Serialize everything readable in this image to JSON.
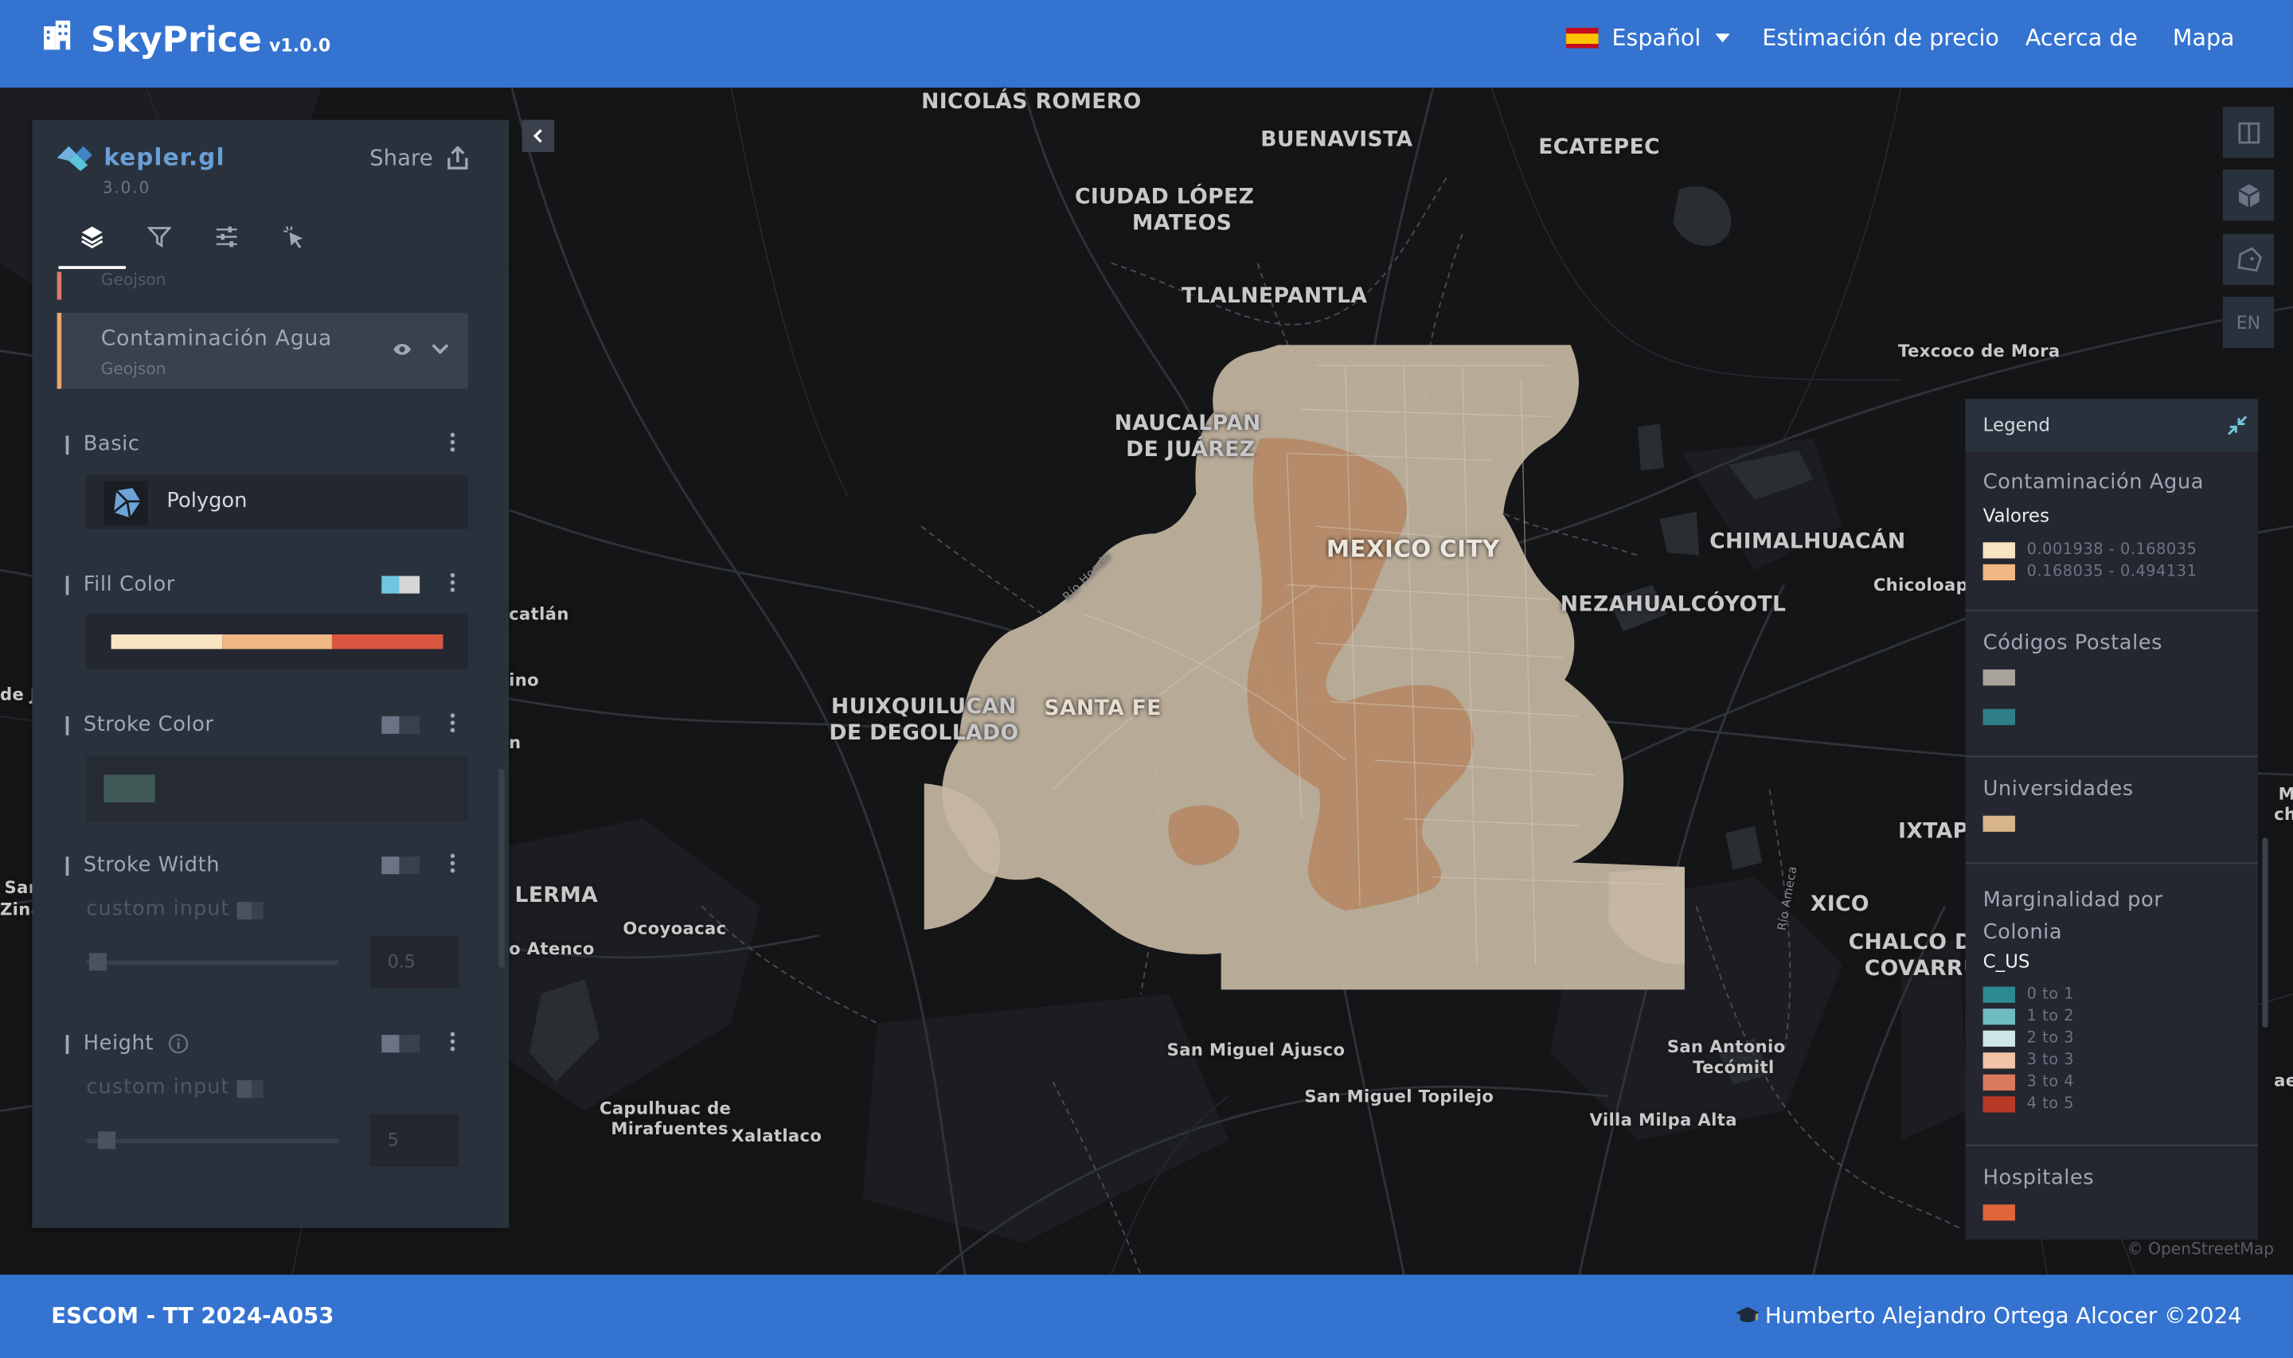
{
  "navbar": {
    "brand_name": "SkyPrice",
    "brand_version": "v1.0.0",
    "language": "Español",
    "links": [
      "Estimación de precio",
      "Acerca de",
      "Mapa"
    ],
    "color": "#3473d0"
  },
  "footer": {
    "left": "ESCOM - TT 2024-A053",
    "right": "Humberto Alejandro Ortega Alcocer ©2024"
  },
  "kepler": {
    "name": "kepler.gl",
    "version": "3.0.0",
    "share_label": "Share",
    "tabs": [
      "layers-tab",
      "filters-tab",
      "interactions-tab",
      "basemap-tab"
    ],
    "prev_layer_sub": "Geojson",
    "layer": {
      "title": "Contaminación Agua",
      "sub": "Geojson"
    },
    "basic_label": "Basic",
    "layer_type": "Polygon",
    "fill_color_label": "Fill Color",
    "fill_ramp": [
      "#f8e3c2",
      "#f0b883",
      "#d95641"
    ],
    "stroke_color_label": "Stroke Color",
    "stroke_swatch": "#3f5956",
    "stroke_width_label": "Stroke Width",
    "custom_input_label": "custom input",
    "stroke_width_value": "0.5",
    "height_label": "Height",
    "height_custom_input_label": "custom input",
    "height_value": "5"
  },
  "map_controls": {
    "lang_button": "EN"
  },
  "legend": {
    "title": "Legend",
    "sections": [
      {
        "title": "Contaminación Agua",
        "sub": "Valores",
        "rows": [
          {
            "color": "#f8e3c2",
            "label": "0.001938 - 0.168035"
          },
          {
            "color": "#f0b883",
            "label": "0.168035 - 0.494131"
          }
        ]
      },
      {
        "title": "Códigos Postales",
        "swatches": [
          "#a8a39a",
          "#2e7f86"
        ]
      },
      {
        "title": "Universidades",
        "swatches": [
          "#d8b588"
        ]
      },
      {
        "title_line1": "Marginalidad por",
        "title_line2": "Colonia",
        "sub": "C_US",
        "rows": [
          {
            "color": "#2b8a94",
            "label": "0 to 1"
          },
          {
            "color": "#6fbcc0",
            "label": "1 to 2"
          },
          {
            "color": "#cde7e6",
            "label": "2 to 3"
          },
          {
            "color": "#f2c3a6",
            "label": "3 to 3"
          },
          {
            "color": "#d97a5c",
            "label": "3 to 4"
          },
          {
            "color": "#b83a26",
            "label": "4 to 5"
          }
        ]
      },
      {
        "title": "Hospitales",
        "swatches": [
          "#e0643a"
        ]
      }
    ]
  },
  "map": {
    "places": [
      "NICOLÁS ROMERO",
      "BUENAVISTA",
      "ECATEPEC",
      "CIUDAD LÓPEZ",
      "MATEOS",
      "TLALNEPANTLA",
      "Texcoco de Mora",
      "NAUCALPAN",
      "DE JUÁREZ",
      "MEXICO CITY",
      "CHIMALHUACÁN",
      "Chicoloapa",
      "NEZAHUALCÓYOTL",
      "HUIXQUILUCAN",
      "DE DEGOLLADO",
      "SANTA FE",
      "IXTAP",
      "XICO",
      "CHALCO DI",
      "COVARRU",
      "LERMA",
      "Ocoyoacac",
      "o Atenco",
      "catlán",
      "ino",
      "n",
      "de J",
      "San",
      "Zina",
      "San Miguel Ajusco",
      "San Miguel Topilejo",
      "San Antonio",
      "Tecómitl",
      "Villa Milpa Alta",
      "Capulhuac de",
      "Mirafuentes",
      "Xalatlaco",
      "Río Hondo",
      "Río Ameca",
      "M",
      "ch",
      "ae"
    ],
    "attribution": "© OpenStreetMap"
  }
}
